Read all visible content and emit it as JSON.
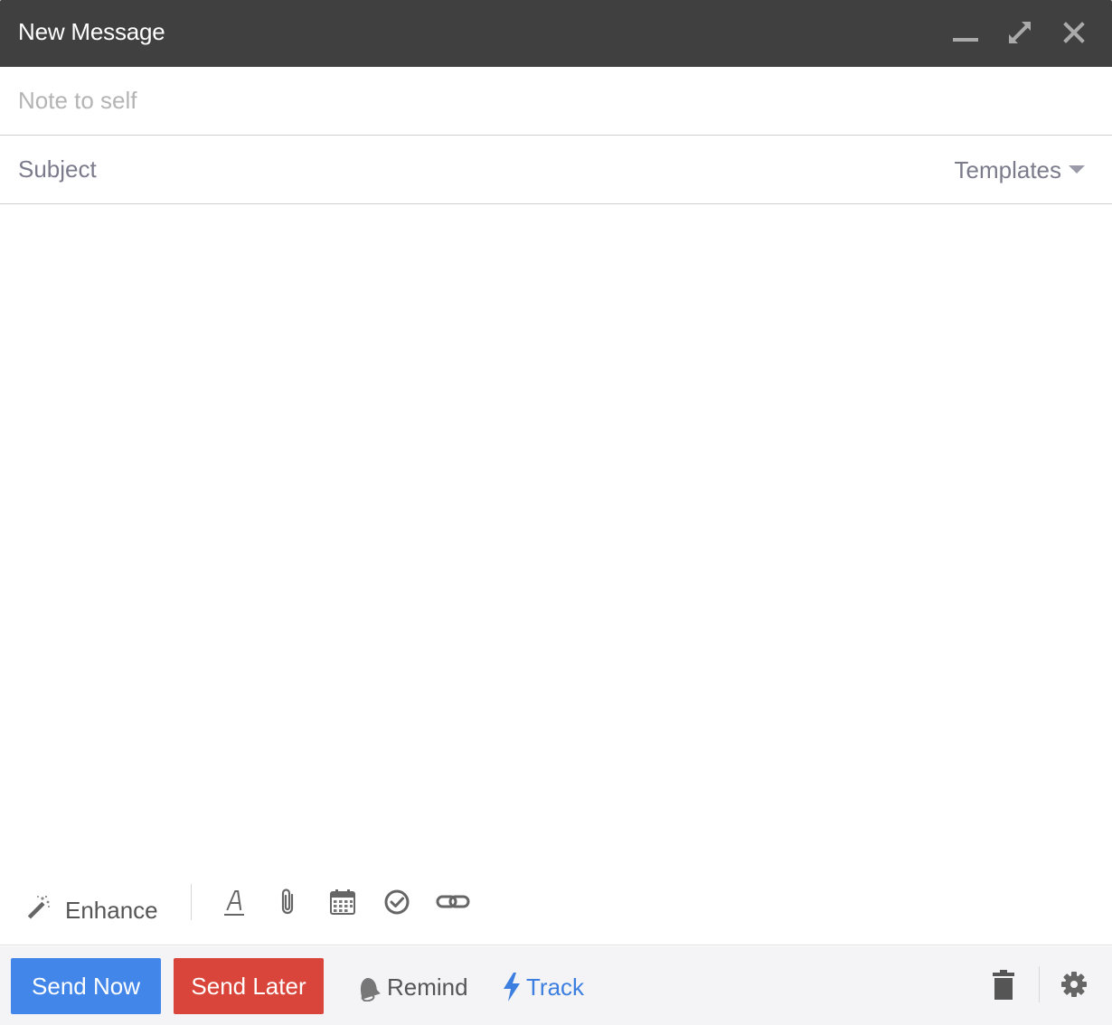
{
  "window": {
    "title": "New Message"
  },
  "titlebar_buttons": {
    "minimize_icon": "minimize-icon",
    "maximize_icon": "expand-icon",
    "close_icon": "close-icon"
  },
  "fields": {
    "to": {
      "value": "",
      "placeholder": "Note to self"
    },
    "subject": {
      "value": "",
      "placeholder": "Subject"
    },
    "templates_label": "Templates"
  },
  "body": {
    "value": ""
  },
  "format_toolbar": {
    "enhance_label": "Enhance",
    "icons": [
      "magic-wand-icon",
      "text-format-icon",
      "paperclip-icon",
      "calendar-icon",
      "check-circle-icon",
      "link-icon"
    ]
  },
  "bottom_bar": {
    "send_now_label": "Send Now",
    "send_later_label": "Send Later",
    "remind_label": "Remind",
    "track_label": "Track"
  },
  "colors": {
    "titlebar": "#404040",
    "send_now": "#4286ea",
    "send_later": "#d9453a",
    "track": "#3d7fe0"
  }
}
